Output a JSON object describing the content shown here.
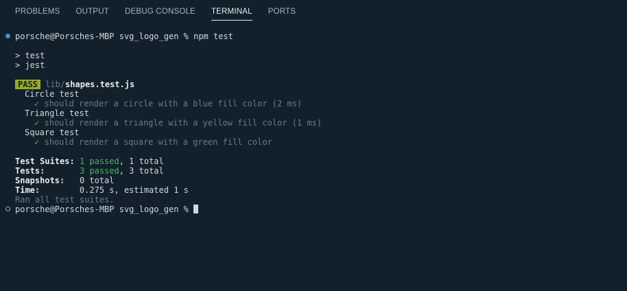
{
  "tabs": [
    "PROBLEMS",
    "OUTPUT",
    "DEBUG CONSOLE",
    "TERMINAL",
    "PORTS"
  ],
  "active_tab": "TERMINAL",
  "terminal": {
    "prompt": "porsche@Porsches-MBP svg_logo_gen % ",
    "command": "npm test",
    "script_lines": [
      "> test",
      "> jest"
    ],
    "pass_badge": "PASS",
    "file_dir": "lib/",
    "file_name": "shapes.test.js",
    "suites": [
      {
        "title": "Circle test",
        "check": "✓",
        "test": "should render a circle with a blue fill color (2 ms)"
      },
      {
        "title": "Triangle test",
        "check": "✓",
        "test": "should render a triangle with a yellow fill color (1 ms)"
      },
      {
        "title": "Square test",
        "check": "✓",
        "test": "should render a square with a green fill color"
      }
    ],
    "summary": {
      "suites_label": "Test Suites:",
      "suites_passed": "1 passed",
      "suites_total": ", 1 total",
      "tests_label": "Tests:",
      "tests_passed": "3 passed",
      "tests_total": ", 3 total",
      "snapshots_label": "Snapshots:",
      "snapshots_value": "0 total",
      "time_label": "Time:",
      "time_value": "0.275 s, estimated 1 s"
    },
    "ran_all": "Ran all test suites.",
    "prompt2": "porsche@Porsches-MBP svg_logo_gen % "
  },
  "colors": {
    "background": "#11202a",
    "pass_badge": "#9aab1c",
    "success_deco": "#4a8fd0",
    "check": "#46b46a"
  }
}
